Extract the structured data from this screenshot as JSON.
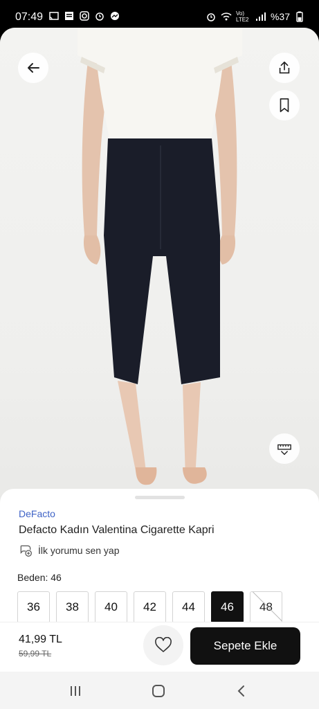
{
  "status_bar": {
    "time": "07:49",
    "battery": "%37",
    "network": "Vo) LTE2",
    "left_icons": [
      "cast-icon",
      "news-icon",
      "instagram-icon",
      "alarm-icon",
      "messenger-icon"
    ],
    "right_icons": [
      "alarm-icon",
      "wifi-icon",
      "signal-icon",
      "battery-icon"
    ]
  },
  "product": {
    "brand": "DeFacto",
    "title": "Defacto Kadın Valentina Cigarette Kapri",
    "review_prompt": "İlk yorumu sen yap",
    "size_label": "Beden: 46",
    "sizes": [
      {
        "label": "36",
        "state": "available"
      },
      {
        "label": "38",
        "state": "available"
      },
      {
        "label": "40",
        "state": "available"
      },
      {
        "label": "42",
        "state": "available"
      },
      {
        "label": "44",
        "state": "available"
      },
      {
        "label": "46",
        "state": "selected"
      },
      {
        "label": "48",
        "state": "unavailable"
      }
    ]
  },
  "bottom": {
    "price": "41,99 TL",
    "old_price": "59,99 TL",
    "add_to_cart": "Sepete Ekle"
  },
  "colors": {
    "brand_link": "#3f63c6",
    "primary_button": "#111111",
    "pants": "#1a1d29",
    "shirt": "#f7f6f2"
  }
}
